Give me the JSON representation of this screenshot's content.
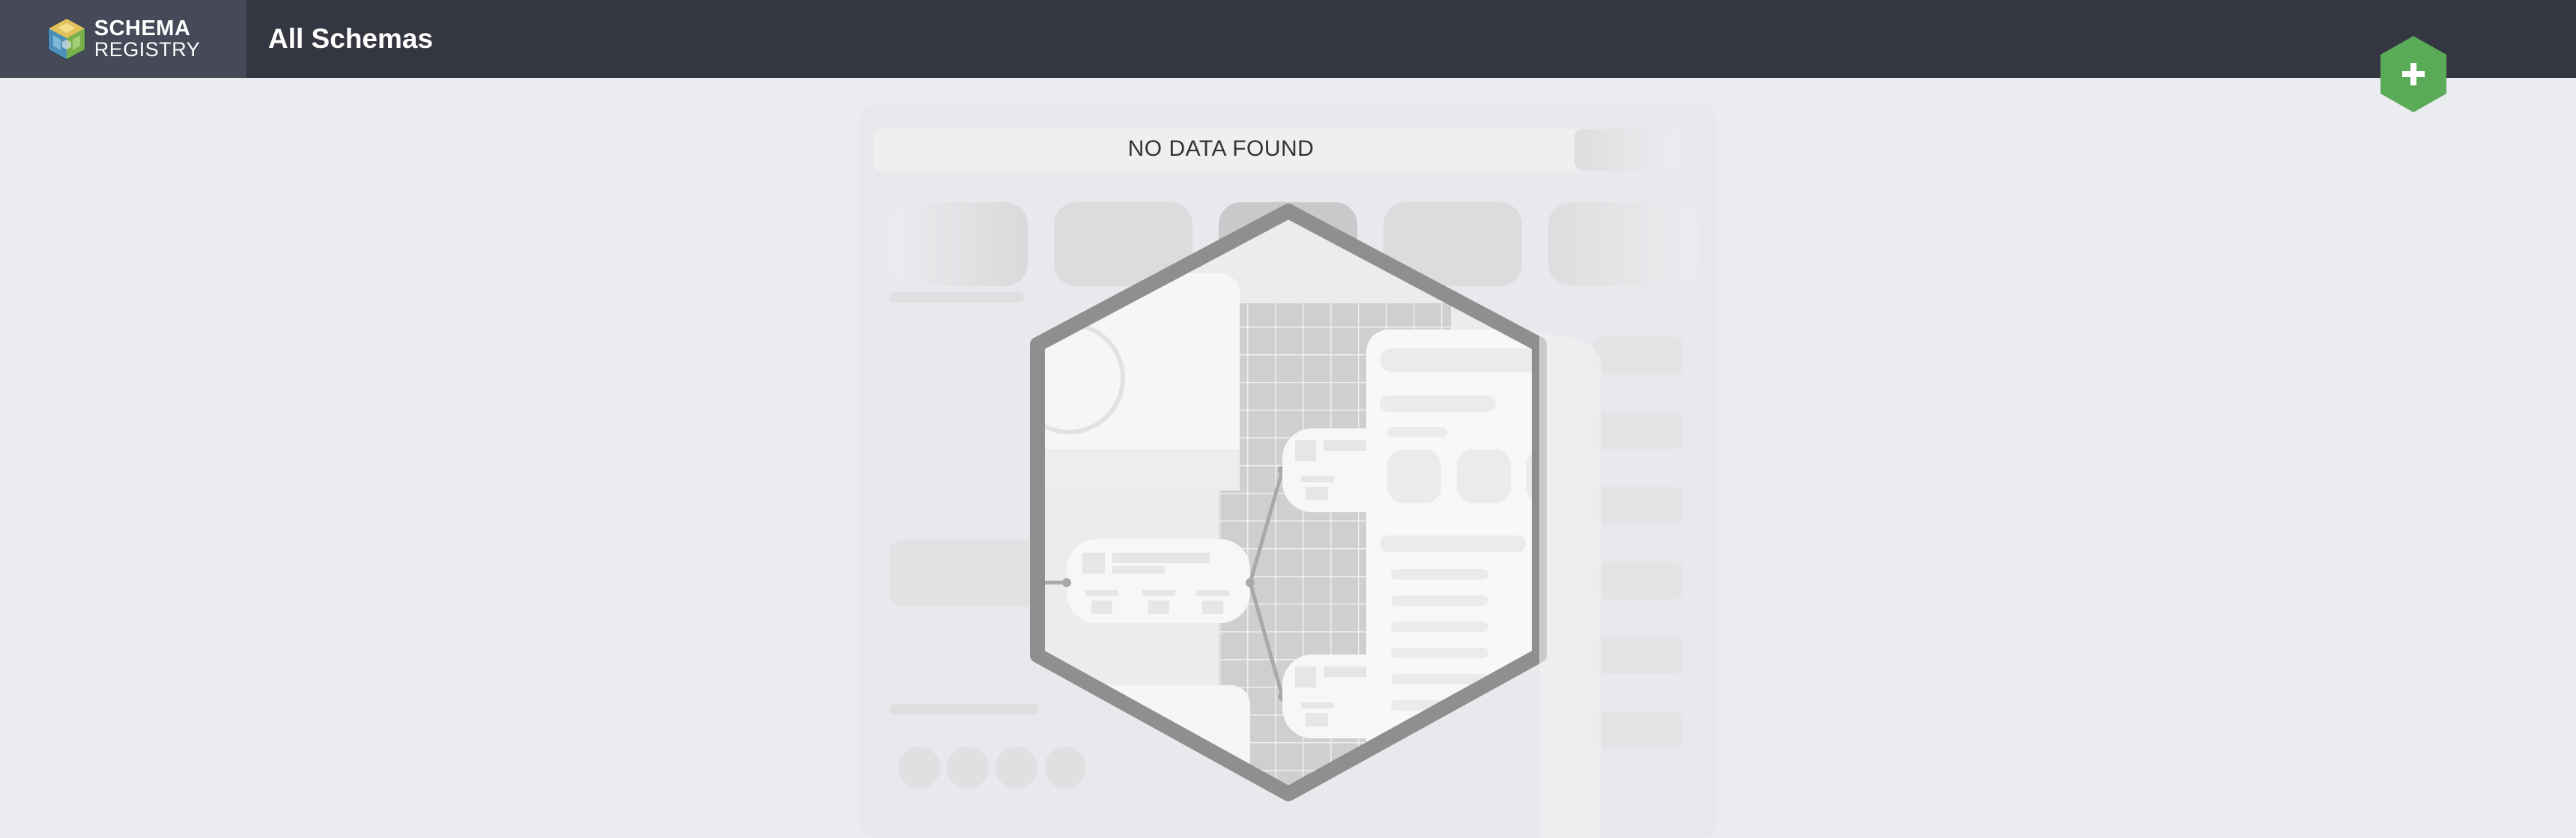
{
  "header": {
    "brand": {
      "line1": "SCHEMA",
      "line2": "REGISTRY",
      "logo_icon": "schema-cube-icon"
    },
    "title": "All Schemas",
    "add_button": {
      "icon": "plus-icon",
      "color": "#5aab57"
    }
  },
  "empty_state": {
    "message": "NO DATA FOUND",
    "illustration_icon": "hexagon-canvas-illustration"
  },
  "colors": {
    "header_bg": "#343642",
    "brand_bg": "#454958",
    "page_bg": "#ebecef",
    "accent_green": "#5aab57",
    "hexagon_stroke": "#8f8f8f"
  }
}
